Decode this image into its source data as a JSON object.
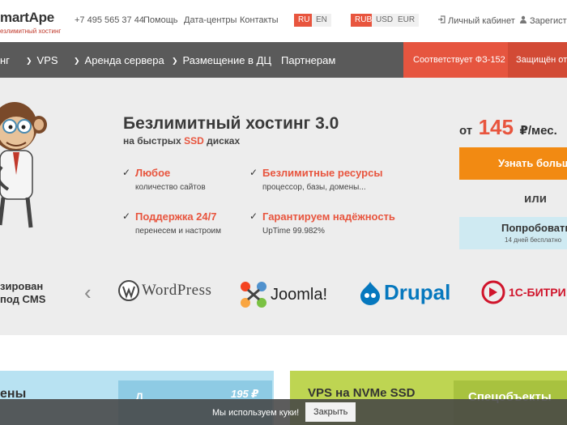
{
  "header": {
    "logo_name": "martApe",
    "logo_tagline": "езлимитный хостинг",
    "phone": "+7 495 565 37 44",
    "links": [
      "Помощь",
      "Дата-центры",
      "Контакты"
    ],
    "languages": [
      "RU",
      "EN"
    ],
    "active_language": "RU",
    "currencies": [
      "RUB",
      "USD",
      "EUR"
    ],
    "active_currency": "RUB",
    "account_label": "Личный кабинет",
    "register_label": "Зарегистр"
  },
  "nav": {
    "items": [
      "нг",
      "VPS",
      "Аренда сервера",
      "Размещение в ДЦ",
      "Партнерам"
    ],
    "badge_1": "Соответствует ФЗ-152",
    "badge_2": "Защищён от D"
  },
  "hero": {
    "title": "Безлимитный хостинг 3.0",
    "subtitle_prefix": "на быстрых",
    "subtitle_highlight": "SSD",
    "subtitle_suffix": "дисках",
    "features": [
      {
        "title": "Любое",
        "desc": "количество сайтов"
      },
      {
        "title": "Безлимитные ресурсы",
        "desc": "процессор, базы, домены..."
      },
      {
        "title": "Поддержка 24/7",
        "desc": "перенесем и настроим"
      },
      {
        "title": "Гарантируем надёжность",
        "desc": "UpTime 99.982%"
      }
    ],
    "price_from": "от",
    "price_value": "145",
    "price_unit": "₽/мес.",
    "learn_more_button": "Узнать больш",
    "or_text": "или",
    "try_button": "Попробовать",
    "try_note": "14 дней бесплатно"
  },
  "cms": {
    "label_line1": "зирован",
    "label_line2": "под CMS",
    "prev_arrow": "‹",
    "logos": [
      "WordPress",
      "Joomla!",
      "Drupal",
      "1С-БИТРИ"
    ]
  },
  "cards": {
    "card1_title": "ены",
    "card1_letter": "Л",
    "card1_price": "195 ₽",
    "card2_title": "VPS на NVMe SSD",
    "card2_side": "Спецобъекты"
  },
  "cookie": {
    "text": "Мы используем куки!",
    "button": "Закрыть"
  },
  "colors": {
    "accent_red": "#e8553e",
    "accent_orange": "#f28a12",
    "nav_gray": "#5a5a5a",
    "light_blue": "#cfeaf2",
    "lime": "#bed552"
  }
}
